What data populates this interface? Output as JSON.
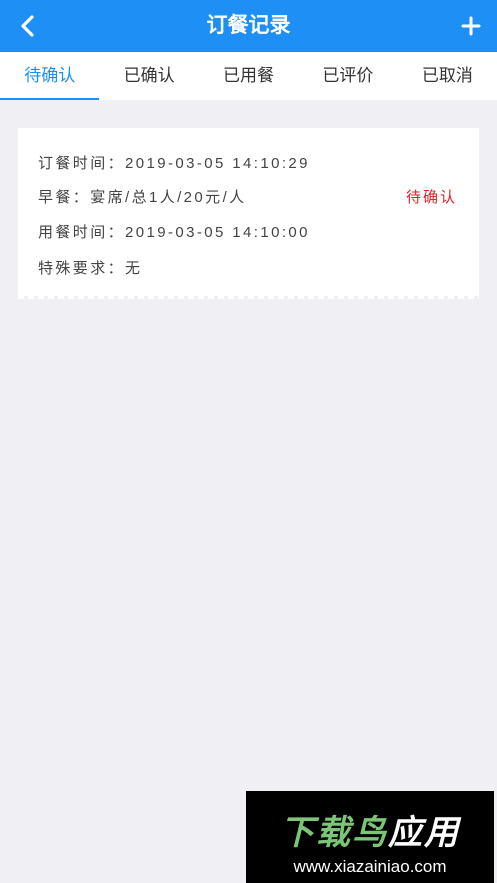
{
  "header": {
    "title": "订餐记录",
    "back_icon": "chevron-left-icon",
    "add_icon": "plus-icon"
  },
  "tabs": [
    {
      "label": "待确认",
      "active": true
    },
    {
      "label": "已确认",
      "active": false
    },
    {
      "label": "已用餐",
      "active": false
    },
    {
      "label": "已评价",
      "active": false
    },
    {
      "label": "已取消",
      "active": false
    }
  ],
  "order": {
    "order_time": "订餐时间：2019-03-05 14:10:29",
    "meal_info": "早餐：宴席/总1人/20元/人",
    "dining_time": "用餐时间：2019-03-05 14:10:00",
    "special_request": "特殊要求：无",
    "status": "待确认"
  },
  "watermark": {
    "logo": "下载鸟应用",
    "url": "www.xiazainiao.com"
  },
  "colors": {
    "primary": "#1e90f5",
    "status_pending": "#e5202a",
    "background": "#efeff4"
  }
}
